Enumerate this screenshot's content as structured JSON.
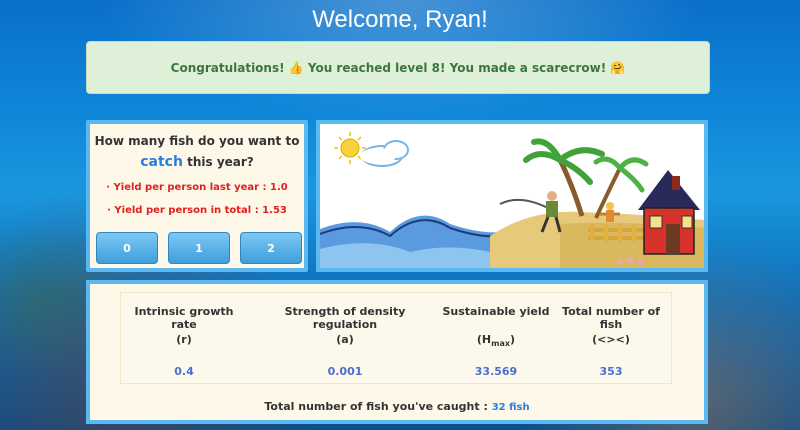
{
  "header": {
    "title": "Welcome, Ryan!"
  },
  "banner": {
    "text": "Congratulations! 👍 You reached level 8! You made a scarecrow! 🤗"
  },
  "question": {
    "line1": "How many fish do you want to",
    "catch_word": "catch",
    "line2_rest": " this year?",
    "yield_last_year": "· Yield per person last year : 1.0",
    "yield_total": "· Yield per person in total : 1.53",
    "buttons": [
      "0",
      "1",
      "2"
    ]
  },
  "stats": {
    "growth": {
      "header": "Intrinsic growth rate",
      "unit": "(r)",
      "value": "0.4"
    },
    "density": {
      "header": "Strength of density regulation",
      "unit": "(a)",
      "value": "0.001"
    },
    "sustain": {
      "header": "Sustainable yield",
      "unit_main": "(H",
      "unit_sub": "max",
      "unit_end": ")",
      "value": "33.569"
    },
    "total": {
      "header": "Total number of fish",
      "unit": "(<><)",
      "value": "353"
    }
  },
  "caught": {
    "label": "Total number of fish you've caught : ",
    "value": "32 fish"
  },
  "colors": {
    "accent": "#5bb8f0",
    "banner_bg": "#dff0d8",
    "value_blue": "#4a6fd0",
    "warning_red": "#e02020"
  },
  "icons": [
    "sun-icon",
    "cloud-icon",
    "palm-tree-icon",
    "fisherman-icon",
    "scarecrow-icon",
    "house-icon"
  ]
}
